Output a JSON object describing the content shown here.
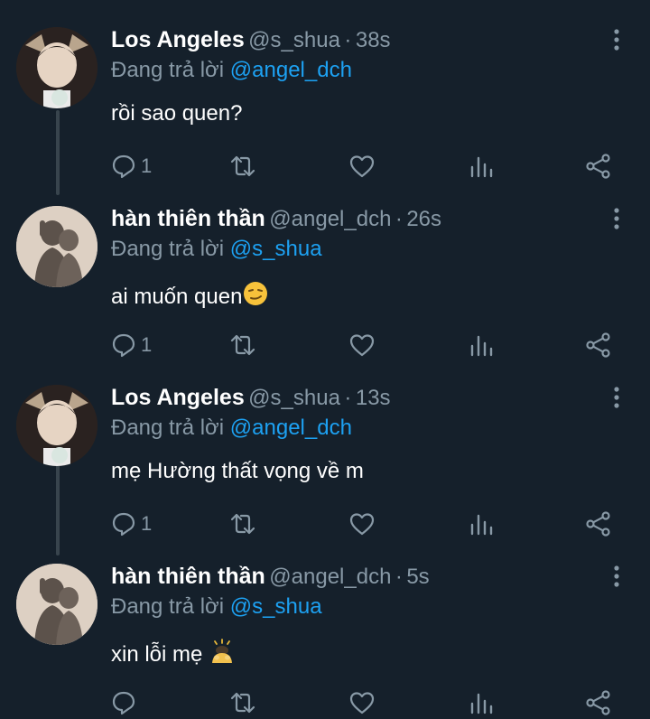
{
  "reply_prefix": "Đang trả lời",
  "separator": "·",
  "tweets": [
    {
      "name": "Los Angeles",
      "handle": "@s_shua",
      "time": "38s",
      "replying_to": "@angel_dch",
      "text": "rồi sao quen?",
      "reply_count": "1",
      "emoji": ""
    },
    {
      "name": "hàn thiên thần",
      "handle": "@angel_dch",
      "time": "26s",
      "replying_to": "@s_shua",
      "text": "ai muốn quen",
      "reply_count": "1",
      "emoji": "smirking-face"
    },
    {
      "name": "Los Angeles",
      "handle": "@s_shua",
      "time": "13s",
      "replying_to": "@angel_dch",
      "text": "mẹ Hường thất vọng về m",
      "reply_count": "1",
      "emoji": ""
    },
    {
      "name": "hàn thiên thần",
      "handle": "@angel_dch",
      "time": "5s",
      "replying_to": "@s_shua",
      "text": "xin lỗi mẹ ",
      "reply_count": "",
      "emoji": "bowing-person"
    }
  ],
  "colors": {
    "background": "#15202b",
    "muted": "#8899a6",
    "link": "#1da1f2",
    "thread_line": "#38444d"
  }
}
